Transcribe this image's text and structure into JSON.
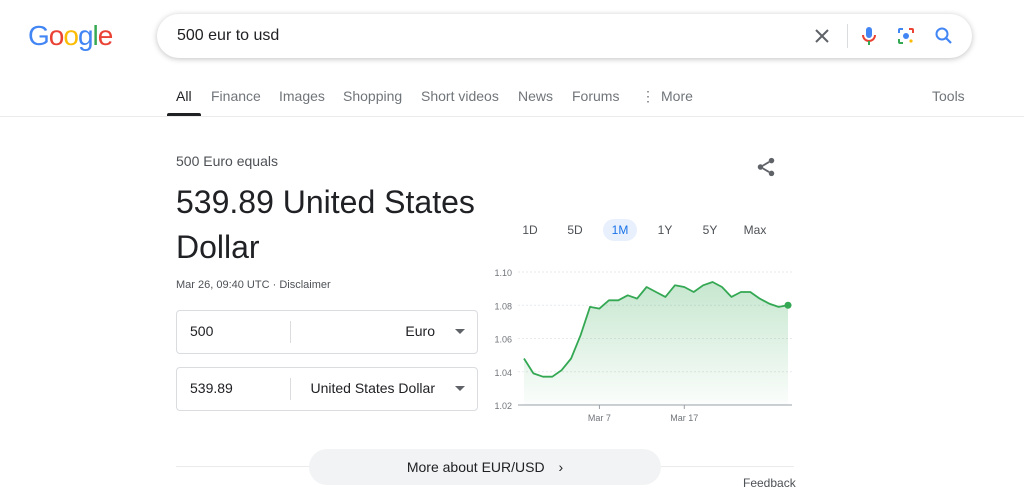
{
  "logo": {
    "text": "Google",
    "colors": [
      "#4285F4",
      "#EA4335",
      "#FBBC05",
      "#4285F4",
      "#34A853",
      "#EA4335"
    ]
  },
  "search": {
    "query": "500 eur to usd"
  },
  "tabs": [
    {
      "label": "All"
    },
    {
      "label": "Finance"
    },
    {
      "label": "Images"
    },
    {
      "label": "Shopping"
    },
    {
      "label": "Short videos"
    },
    {
      "label": "News"
    },
    {
      "label": "Forums"
    },
    {
      "label": "More"
    }
  ],
  "tools_label": "Tools",
  "converter": {
    "equals_text": "500 Euro equals",
    "result_text": "539.89 United States Dollar",
    "timestamp": "Mar 26, 09:40 UTC",
    "meta_separator": "·",
    "disclaimer": "Disclaimer",
    "from": {
      "amount": "500",
      "currency": "Euro"
    },
    "to": {
      "amount": "539.89",
      "currency": "United States Dollar"
    }
  },
  "ranges": [
    "1D",
    "5D",
    "1M",
    "1Y",
    "5Y",
    "Max"
  ],
  "active_range": "1M",
  "chart_data": {
    "type": "area",
    "y_ticks": [
      "1.10",
      "1.08",
      "1.06",
      "1.04",
      "1.02"
    ],
    "ylim": [
      1.02,
      1.1
    ],
    "x_ticks": [
      {
        "label": "Mar 7",
        "index": 8
      },
      {
        "label": "Mar 17",
        "index": 17
      }
    ],
    "values": [
      1.048,
      1.039,
      1.037,
      1.037,
      1.041,
      1.048,
      1.062,
      1.079,
      1.078,
      1.083,
      1.083,
      1.086,
      1.084,
      1.091,
      1.088,
      1.085,
      1.092,
      1.091,
      1.088,
      1.092,
      1.094,
      1.091,
      1.085,
      1.088,
      1.088,
      1.084,
      1.081,
      1.079,
      1.08
    ],
    "line_color": "#34a853",
    "grid": true
  },
  "more_about": "More about EUR/USD",
  "feedback": "Feedback"
}
